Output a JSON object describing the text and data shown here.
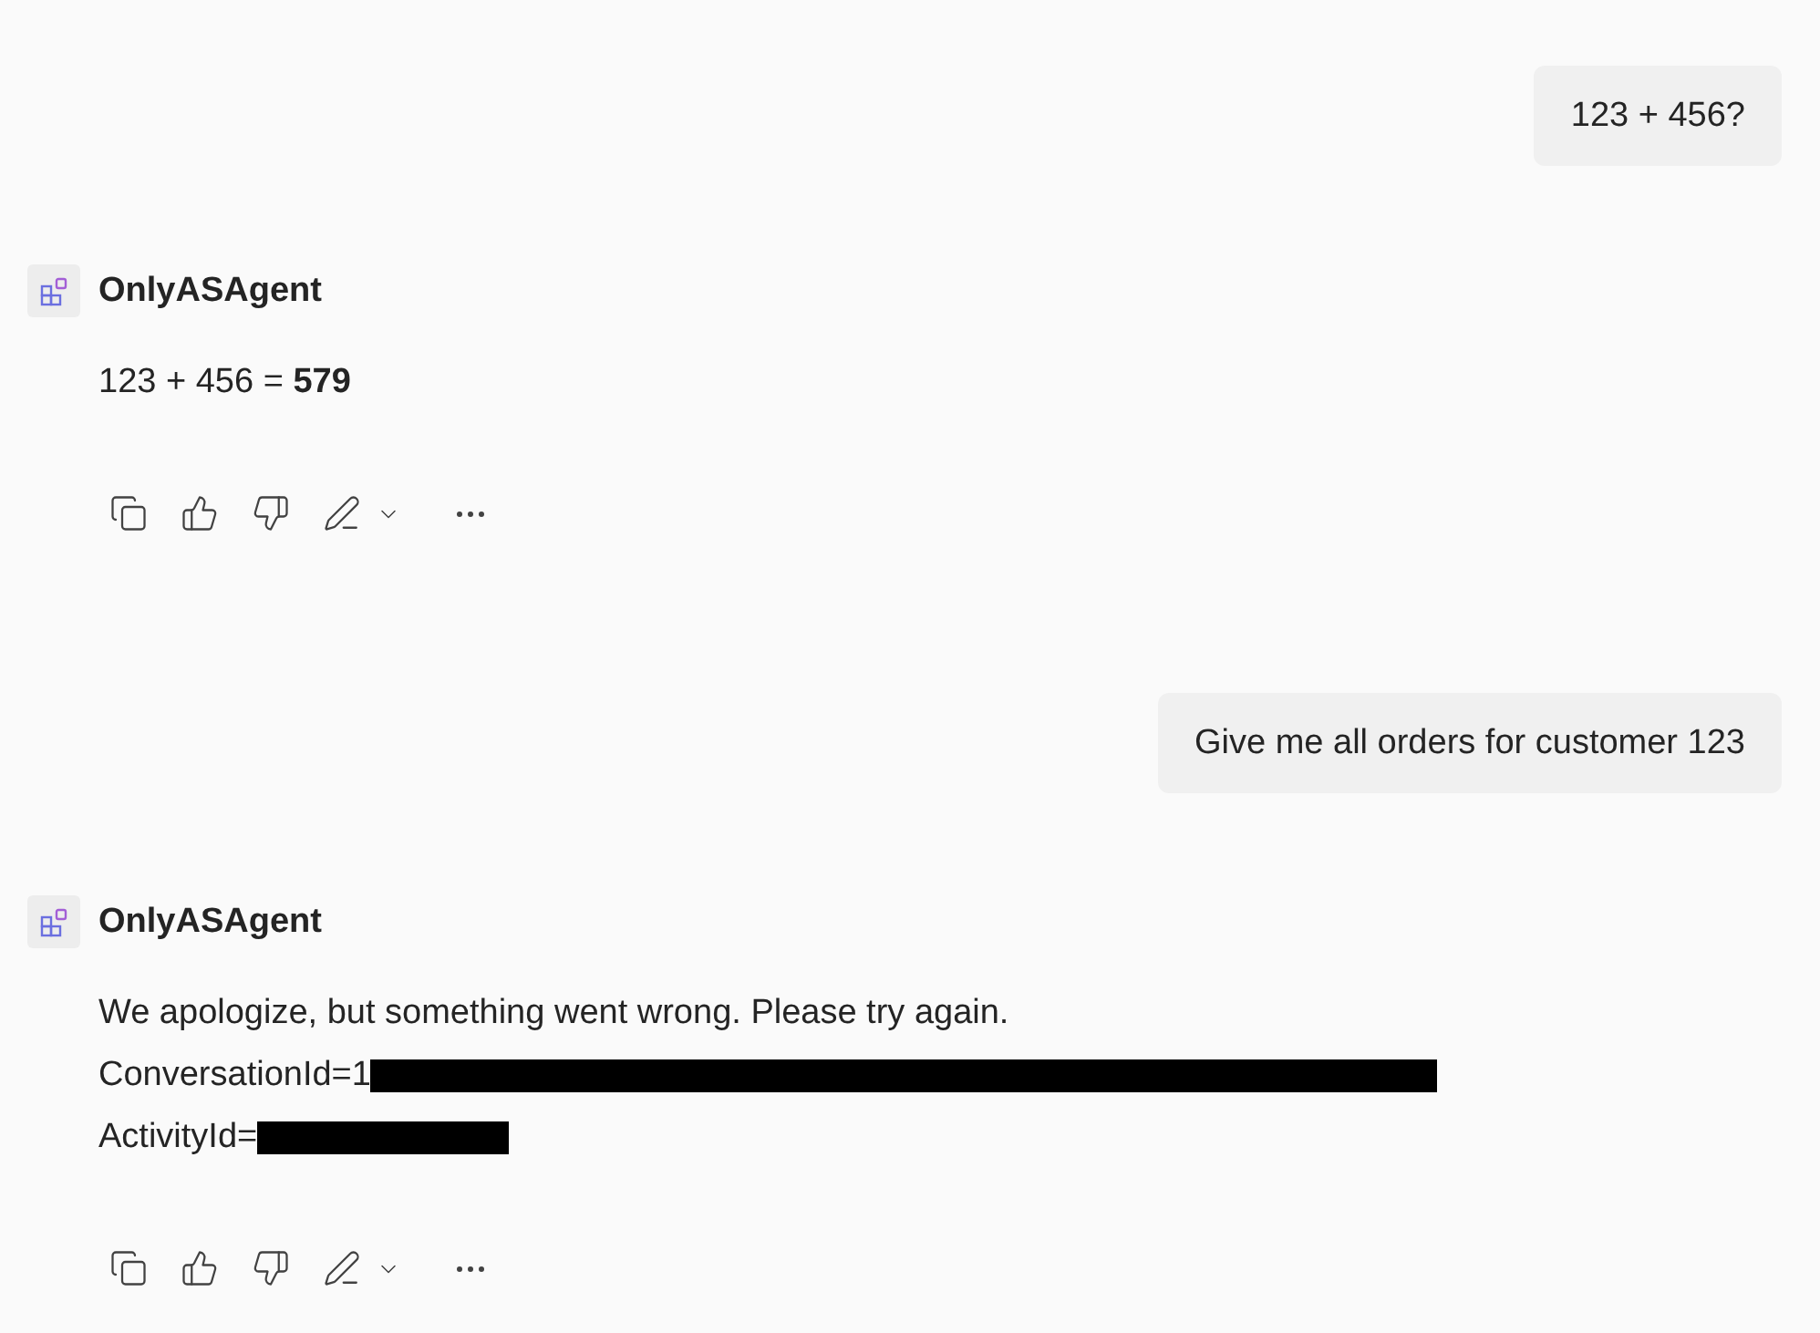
{
  "messages": [
    {
      "kind": "user",
      "text": "123 + 456?"
    },
    {
      "kind": "agent",
      "sender": "OnlyASAgent",
      "lines": [
        {
          "text": "123 + 456 = **579**"
        }
      ]
    },
    {
      "kind": "user",
      "text": "Give me all orders for customer 123"
    },
    {
      "kind": "agent",
      "sender": "OnlyASAgent",
      "lines": [
        {
          "text": "We apologize, but something went wrong. Please try again."
        },
        {
          "text": "ConversationId=1",
          "redacted": true,
          "wide": true
        },
        {
          "text": "ActivityId=",
          "redacted": true,
          "wide": false
        }
      ]
    }
  ]
}
